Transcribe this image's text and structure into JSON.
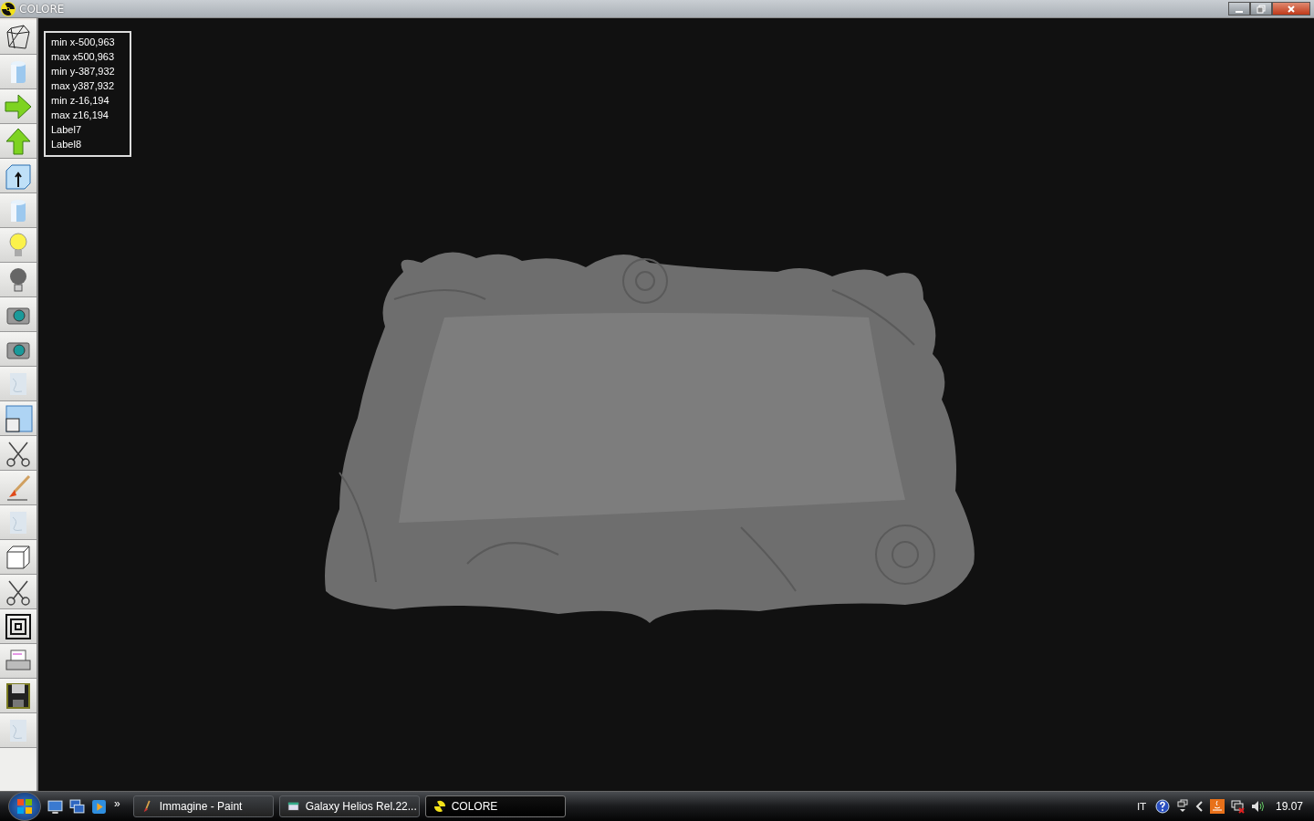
{
  "window": {
    "title": "COLORE"
  },
  "toolbar": [
    {
      "kind": "wireframe"
    },
    {
      "kind": "cylinder"
    },
    {
      "kind": "arrow-right"
    },
    {
      "kind": "arrow-up"
    },
    {
      "kind": "box-arrow"
    },
    {
      "kind": "cylinder"
    },
    {
      "kind": "bulb-on"
    },
    {
      "kind": "bulb-off"
    },
    {
      "kind": "camera"
    },
    {
      "kind": "camera"
    },
    {
      "kind": "texture"
    },
    {
      "kind": "window"
    },
    {
      "kind": "scissors"
    },
    {
      "kind": "brush"
    },
    {
      "kind": "texture"
    },
    {
      "kind": "cube"
    },
    {
      "kind": "scissors"
    },
    {
      "kind": "squares"
    },
    {
      "kind": "printer"
    },
    {
      "kind": "floppy"
    },
    {
      "kind": "texture"
    }
  ],
  "info_labels": [
    "min x-500,963",
    "max x500,963",
    "min y-387,932",
    "max y387,932",
    "min z-16,194",
    "max z16,194",
    "Label7",
    "Label8"
  ],
  "taskbar": {
    "overflow": "»",
    "tasks": [
      {
        "kind": "paint",
        "label": "Immagine - Paint",
        "selected": false
      },
      {
        "kind": "window",
        "label": "Galaxy Helios  Rel.22...",
        "selected": false
      },
      {
        "kind": "radiation",
        "label": "COLORE",
        "selected": true
      }
    ],
    "language": "IT",
    "clock": "19.07"
  }
}
